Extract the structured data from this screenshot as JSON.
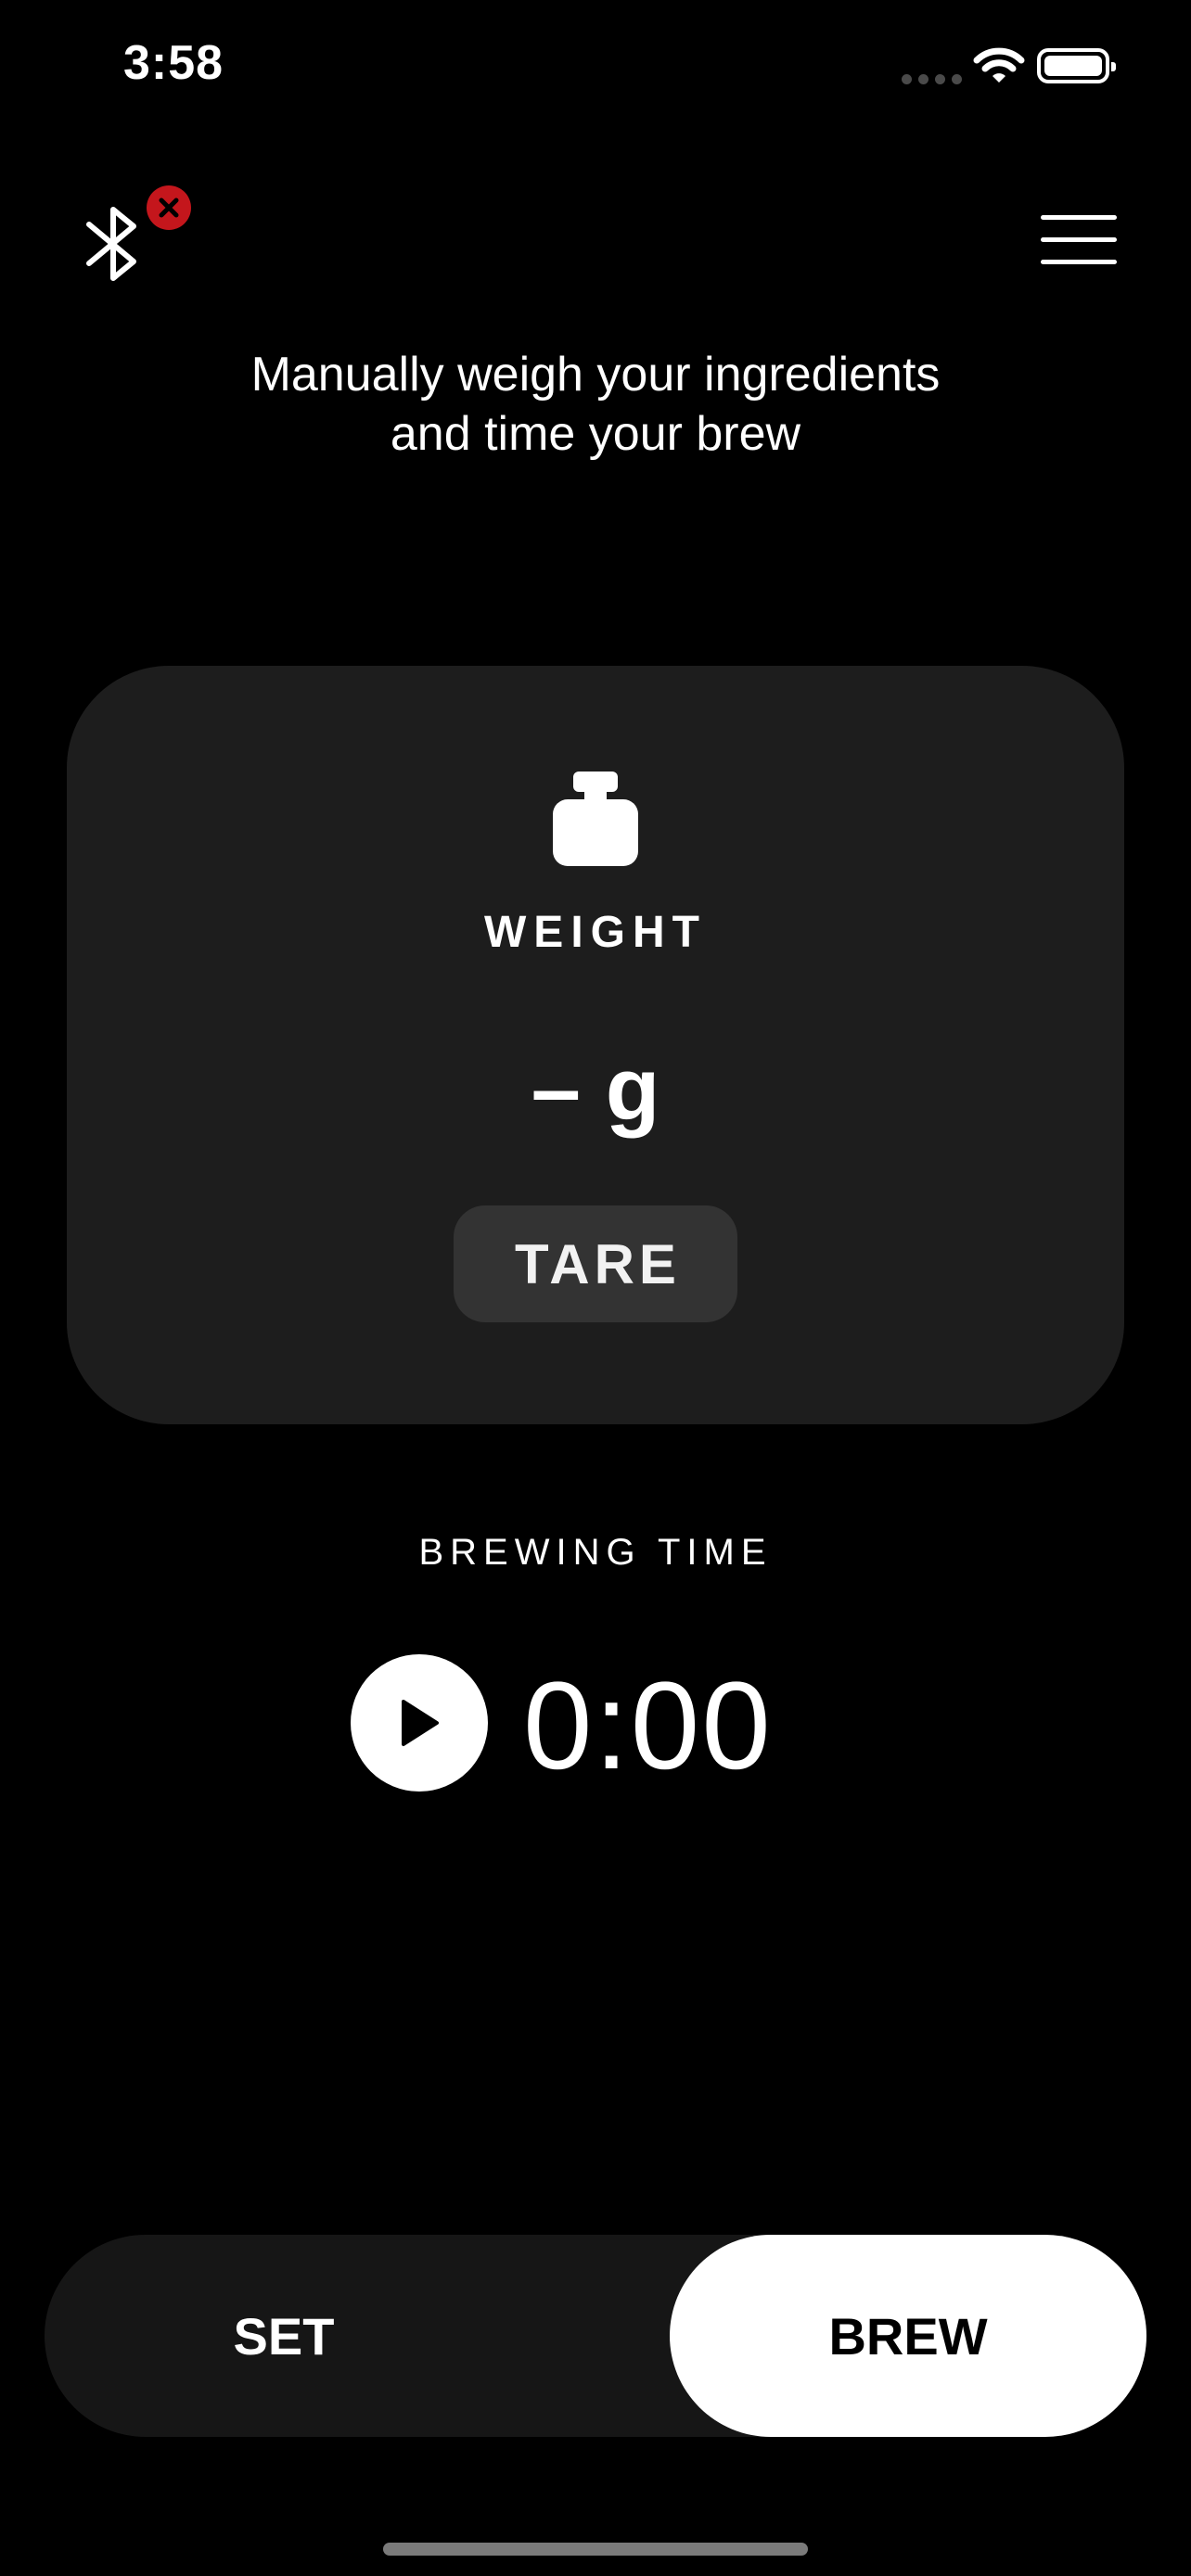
{
  "status_bar": {
    "time": "3:58",
    "icons": [
      "cellular-signal-icon",
      "wifi-icon",
      "battery-icon"
    ]
  },
  "header": {
    "bluetooth_icon": "bluetooth-icon",
    "bluetooth_status_icon": "disconnected-x-icon",
    "menu_icon": "hamburger-menu-icon"
  },
  "subtitle": {
    "line1": "Manually weigh your ingredients",
    "line2": "and time your brew"
  },
  "weight_card": {
    "icon": "weight-icon",
    "label": "WEIGHT",
    "value": "– g",
    "tare_label": "TARE"
  },
  "brewing": {
    "label": "BREWING TIME",
    "play_icon": "play-icon",
    "timer": "0:00"
  },
  "mode_toggle": {
    "options": [
      "SET",
      "BREW"
    ],
    "selected": "BREW"
  },
  "colors": {
    "background": "#000000",
    "card": "#1d1d1d",
    "tare_button": "#333333",
    "alert_badge": "#c4161c",
    "toggle_track": "#161616",
    "toggle_active": "#ffffff"
  }
}
